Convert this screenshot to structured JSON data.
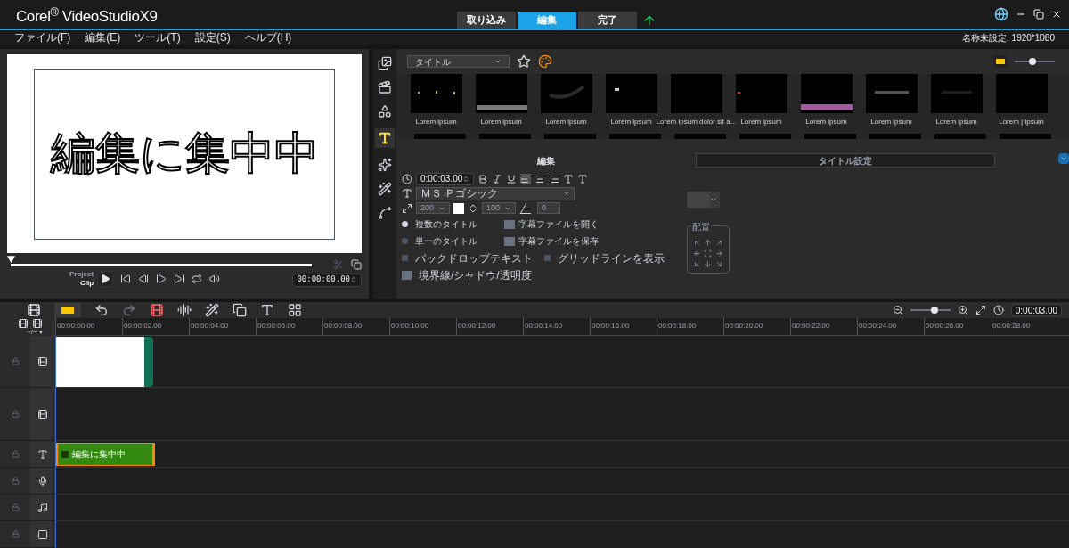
{
  "app": {
    "brand": "Corel$^{®}$",
    "product": "VideoStudio",
    "version": "X9"
  },
  "mode_tabs": [
    {
      "label": "取り込み",
      "selected": false
    },
    {
      "label": "編集",
      "selected": true
    },
    {
      "label": "完了",
      "selected": false
    }
  ],
  "menu": [
    "ファイル(F)",
    "編集(E)",
    "ツール(T)",
    "設定(S)",
    "ヘルプ(H)"
  ],
  "project_info": "名称未設定, 1920*1080",
  "preview": {
    "title_text": "編集に集中中",
    "project_label": "Project",
    "clip_label": "Clip",
    "timecode": "00:00:00.00",
    "scrubber": {
      "level": 0
    }
  },
  "library": {
    "category": "タイトル",
    "size_slider": {
      "level": 0.45
    },
    "thumbnails": [
      {
        "caption": "Lorem ipsum",
        "kind": "picture"
      },
      {
        "caption": "Lorem ipsum",
        "kind": "picture"
      },
      {
        "caption": "Lorem ipsum",
        "kind": "picture"
      },
      {
        "caption": "Lorem ipsum",
        "kind": "picture"
      },
      {
        "caption": "Lorem ipsum dolor sit a...",
        "kind": "picture"
      },
      {
        "caption": "Lorem ipsum",
        "kind": "picture"
      },
      {
        "caption": "Lorem ipsum",
        "kind": "picture"
      },
      {
        "caption": "Lorem ipsum",
        "kind": "picture"
      },
      {
        "caption": "Lorem ipsum",
        "kind": "picture"
      },
      {
        "caption": "Lorem | ipsum",
        "kind": "picture"
      }
    ]
  },
  "edit_tabs": [
    {
      "label": "編集",
      "selected": true
    },
    {
      "label": "タイトル設定",
      "selected": false
    }
  ],
  "options": {
    "duration": "0:00:03.00",
    "font": "ＭＳ Ｐゴシック",
    "size": "200",
    "line_spacing": "100",
    "angle": "0",
    "radios": [
      {
        "label": "複数のタイトル",
        "selected": true
      },
      {
        "label": "単一のタイトル",
        "selected": false
      }
    ],
    "subtitle_links": [
      "字幕ファイルを開く",
      "字幕ファイルを保存"
    ],
    "checkboxes": [
      {
        "label": "バックドロップテキスト",
        "checked": false
      },
      {
        "label": "グリッドラインを表示",
        "checked": false
      }
    ],
    "border_link": "境界線/シャドウ/透明度",
    "align_title": "配置"
  },
  "timeline": {
    "timecode": "0:00:03.00",
    "zoom_slider": {
      "level": 0.6
    },
    "track_manager": "+/− ▾",
    "ruler": [
      "00:00:00.00",
      "00:00:02.00",
      "00:00:04.00",
      "00:00:06.00",
      "00:00:08.00",
      "00:00:10.00",
      "00:00:12.00",
      "00:00:14.00",
      "00:00:16.00",
      "00:00:18.00",
      "00:00:20.00",
      "00:00:22.00",
      "00:00:24.00",
      "00:00:26.00",
      "00:00:28.00"
    ],
    "title_clip": "編集に集中中"
  }
}
